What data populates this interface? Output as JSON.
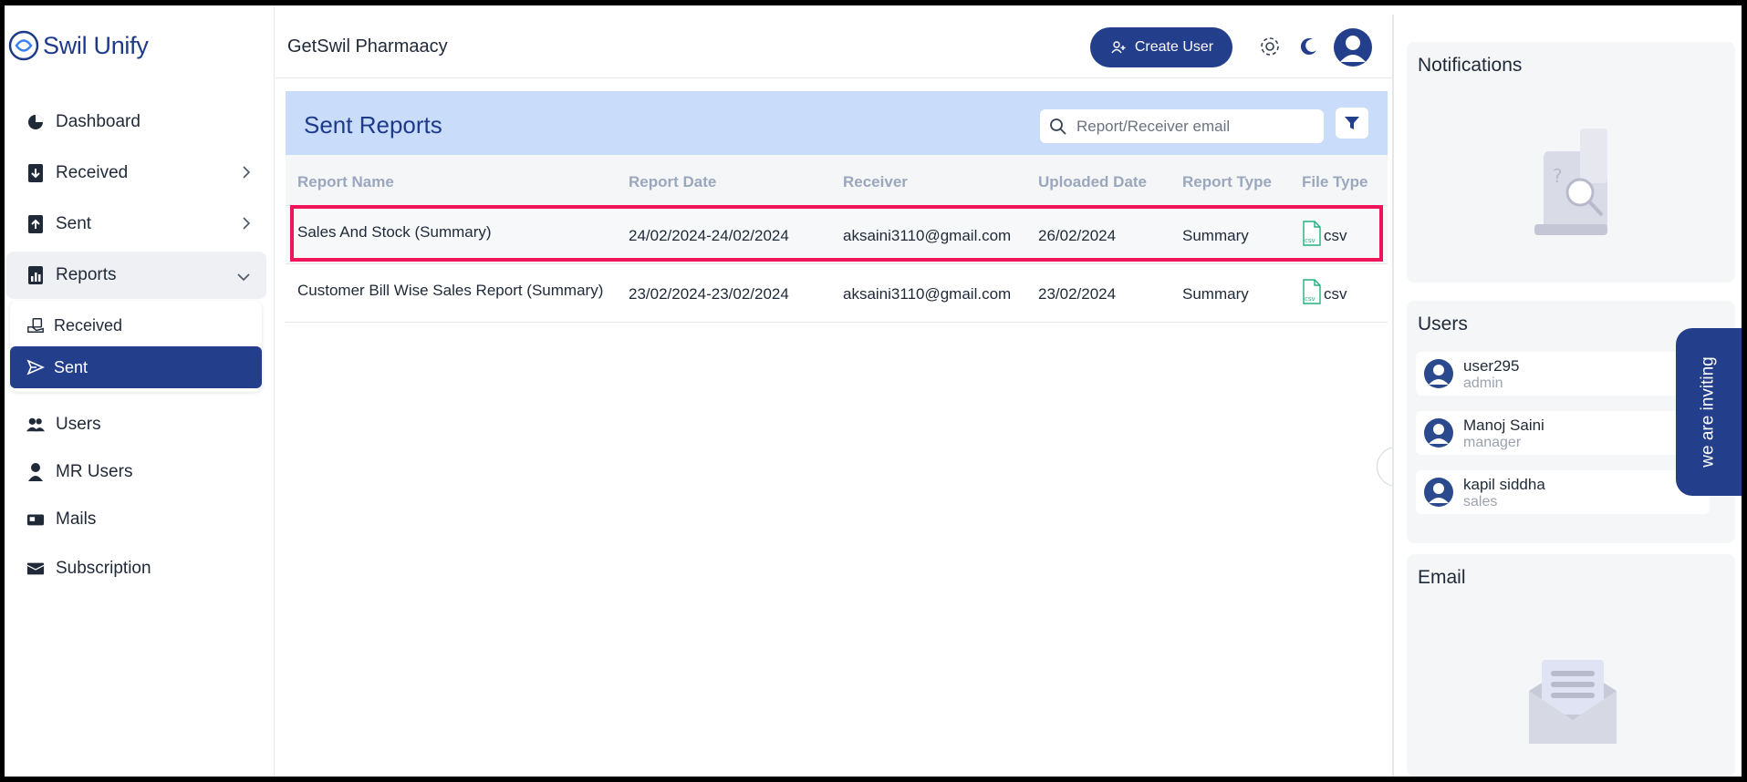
{
  "brand": {
    "name": "Swil Unify",
    "accent": "#233f8b"
  },
  "sidebar": {
    "items": [
      {
        "label": "Dashboard",
        "icon": "pie-chart-icon"
      },
      {
        "label": "Received",
        "icon": "download-doc-icon"
      },
      {
        "label": "Sent",
        "icon": "upload-doc-icon"
      },
      {
        "label": "Reports",
        "icon": "report-icon"
      },
      {
        "label": "Users",
        "icon": "users-icon"
      },
      {
        "label": "MR Users",
        "icon": "mr-user-icon"
      },
      {
        "label": "Mails",
        "icon": "mailbox-icon"
      },
      {
        "label": "Subscription",
        "icon": "subscription-icon"
      }
    ],
    "reports_sub": [
      {
        "label": "Received",
        "icon": "hand-doc-icon"
      },
      {
        "label": "Sent",
        "icon": "send-icon",
        "active": true
      }
    ]
  },
  "topbar": {
    "company": "GetSwil Pharmaacy",
    "create_user_label": "Create User"
  },
  "main": {
    "title": "Sent Reports",
    "search_placeholder": "Report/Receiver email",
    "columns": [
      "Report Name",
      "Report Date",
      "Receiver",
      "Uploaded Date",
      "Report Type",
      "File Type"
    ],
    "rows": [
      {
        "name": "Sales And Stock (Summary)",
        "date": "24/02/2024-24/02/2024",
        "receiver": "aksaini3110@gmail.com",
        "uploaded": "26/02/2024",
        "type": "Summary",
        "file": "csv",
        "highlighted": true
      },
      {
        "name": "Customer Bill Wise Sales Report (Summary)",
        "date": "23/02/2024-23/02/2024",
        "receiver": "aksaini3110@gmail.com",
        "uploaded": "23/02/2024",
        "type": "Summary",
        "file": "csv"
      }
    ]
  },
  "right_panel": {
    "notifications_title": "Notifications",
    "users_title": "Users",
    "users": [
      {
        "name": "user295",
        "role": "admin"
      },
      {
        "name": "Manoj Saini",
        "role": "manager"
      },
      {
        "name": "kapil siddha",
        "role": "sales"
      }
    ],
    "email_title": "Email",
    "invite_label": "we are inviting"
  }
}
